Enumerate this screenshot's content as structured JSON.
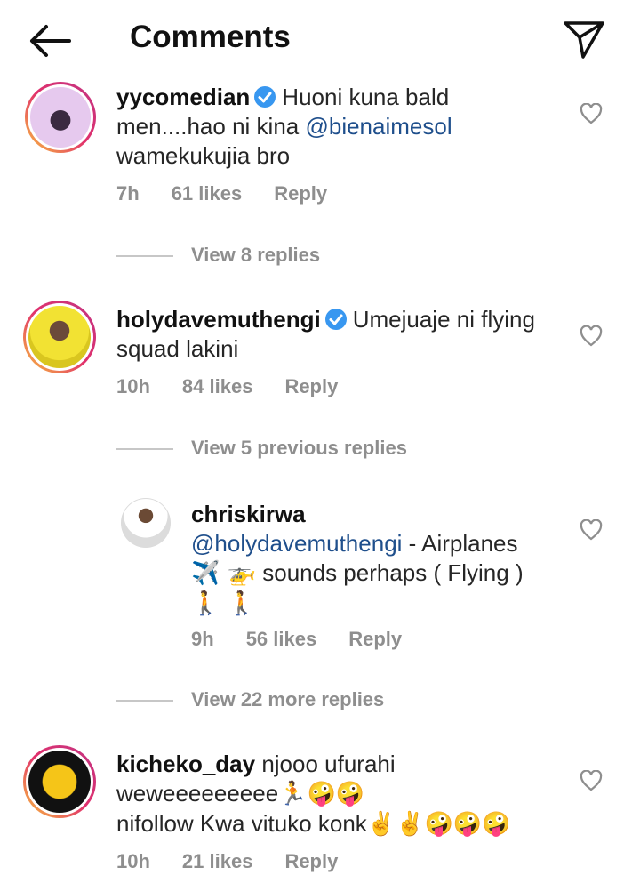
{
  "header": {
    "title": "Comments"
  },
  "comments": [
    {
      "username": "yycomedian",
      "text_part1": "Huoni kuna bald",
      "text_part2": "men....hao ni kina ",
      "mention": "@bienaimesol",
      "text_part3": "wamekukujia bro",
      "time": "7h",
      "likes": "61 likes",
      "reply": "Reply",
      "view": "View 8 replies"
    },
    {
      "username": "holydavemuthengi",
      "text_part1": "Umejuaje ni flying",
      "text_part2": "squad lakini",
      "time": "10h",
      "likes": "84 likes",
      "reply": "Reply",
      "view": "View 5 previous replies"
    }
  ],
  "reply": {
    "username": "chriskirwa",
    "mention": "@holydavemuthengi",
    "text_part1": " - Airplanes",
    "emoji_line1": "✈️ 🚁",
    "text_part2": " sounds perhaps ( Flying )",
    "emoji_line2": "🚶 🚶",
    "time": "9h",
    "likes": "56 likes",
    "reply_label": "Reply",
    "view_more": "View 22 more replies"
  },
  "last_comment": {
    "username": "kicheko_day",
    "text_part1": " njooo ufurahi",
    "text_part2": "weweeeeeeeee",
    "emoji_a": "🏃🤪🤪",
    "text_part3": "nifollow Kwa vituko konk",
    "emoji_b": "✌️✌️🤪🤪🤪",
    "time": "10h",
    "likes": "21 likes",
    "reply": "Reply"
  }
}
